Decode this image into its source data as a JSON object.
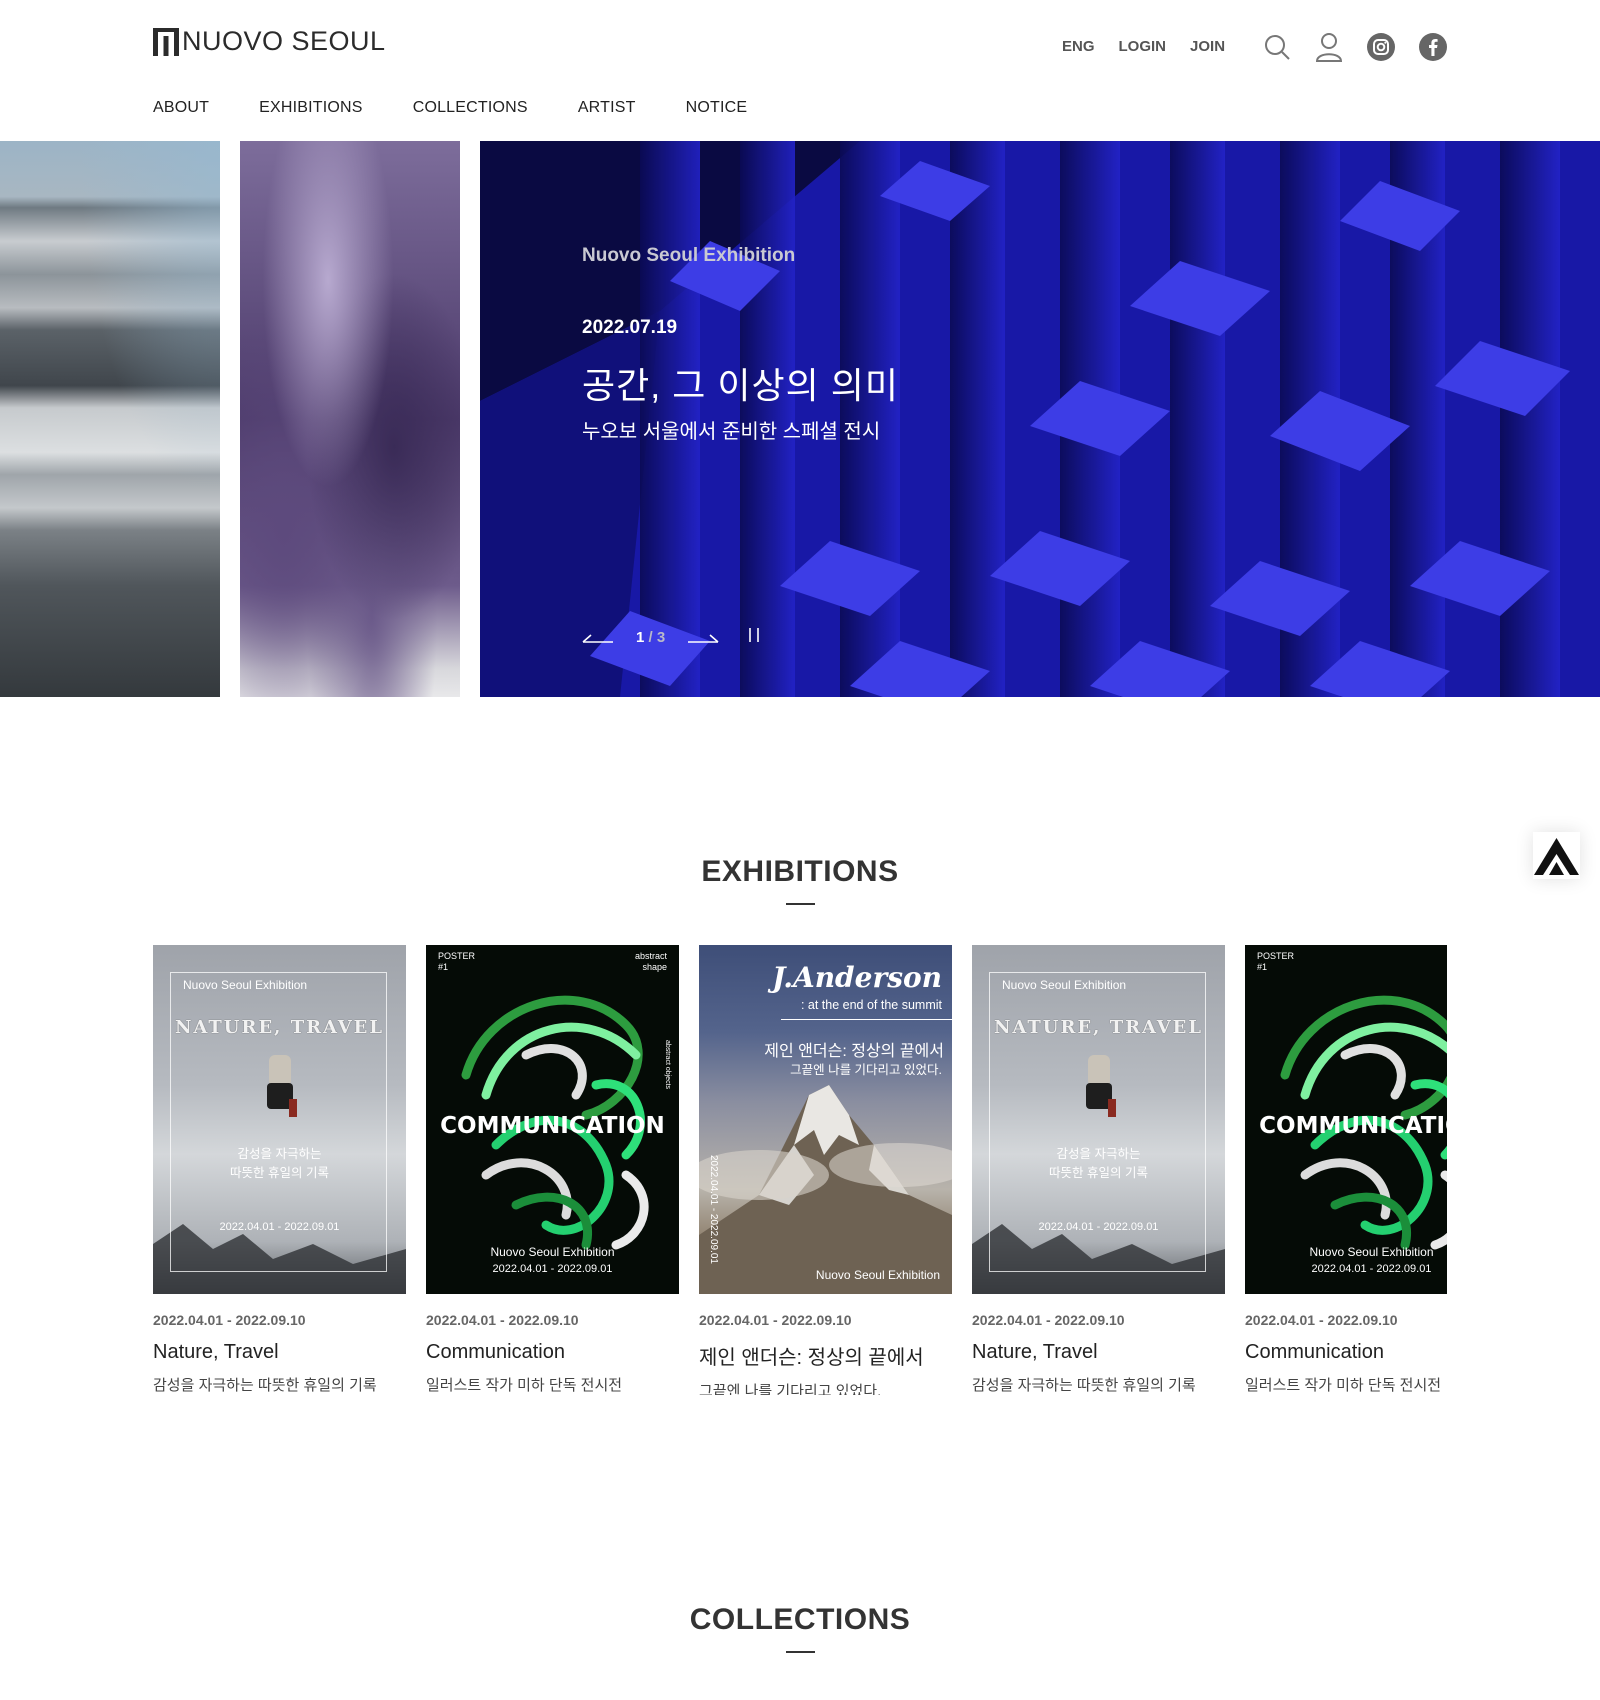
{
  "brand": {
    "name": "NUOVO SEOUL"
  },
  "util_nav": {
    "eng": "ENG",
    "login": "LOGIN",
    "join": "JOIN"
  },
  "icons": [
    "search-icon",
    "user-icon",
    "instagram-icon",
    "facebook-icon",
    "arrow-left-icon",
    "arrow-right-icon",
    "pause-icon",
    "top-arrow-icon"
  ],
  "gnb": [
    "ABOUT",
    "EXHIBITIONS",
    "COLLECTIONS",
    "ARTIST",
    "NOTICE"
  ],
  "hero": {
    "kicker": "Nuovo Seoul Exhibition",
    "date": "2022.07.19",
    "title": "공간, 그 이상의 의미",
    "subtitle": "누오보 서울에서 준비한 스페셜 전시",
    "current": "1",
    "separator": " / ",
    "total": "3"
  },
  "sections": {
    "exhibitions": "EXHIBITIONS",
    "collections": "COLLECTIONS"
  },
  "posters": {
    "nature": {
      "small": "Nuovo Seoul  Exhibition",
      "big": "NATURE, TRAVEL",
      "ko_line1": "감성을 자극하는",
      "ko_line2": "따뜻한 휴일의 기록",
      "dates": "2022.04.01  -  2022.09.01"
    },
    "communication": {
      "top_left_1": "POSTER",
      "top_left_2": "#1",
      "top_right_1": "abstract",
      "top_right_2": "shape",
      "side": "abstract objects",
      "word": "COMMUNICATION",
      "foot1": "Nuovo Seoul  Exhibition",
      "foot2": "2022.04.01  -  2022.09.01"
    },
    "anderson": {
      "name": "J.Anderson",
      "sub": ": at the end of the summit",
      "ko1": "제인 앤더슨: 정상의 끝에서",
      "ko2": "그끝엔 나를 기다리고 있었다.",
      "vert": "2022.04.01 - 2022.09.01",
      "foot": "Nuovo Seoul  Exhibition"
    }
  },
  "exhibitions": [
    {
      "date": "2022.04.01 - 2022.09.10",
      "title": "Nature, Travel",
      "desc": "감성을 자극하는 따뜻한 휴일의 기록"
    },
    {
      "date": "2022.04.01 - 2022.09.10",
      "title": "Communication",
      "desc": "일러스트 작가 미하 단독 전시전"
    },
    {
      "date": "2022.04.01 - 2022.09.10",
      "title": "제인 앤더슨: 정상의 끝에서",
      "desc": "그끝엔 나를 기다리고 있었다."
    },
    {
      "date": "2022.04.01 - 2022.09.10",
      "title": "Nature, Travel",
      "desc": "감성을 자극하는 따뜻한 휴일의 기록"
    },
    {
      "date": "2022.04.01 - 2022.09.10",
      "title": "Communication",
      "desc": "일러스트 작가 미하 단독 전시전"
    }
  ]
}
